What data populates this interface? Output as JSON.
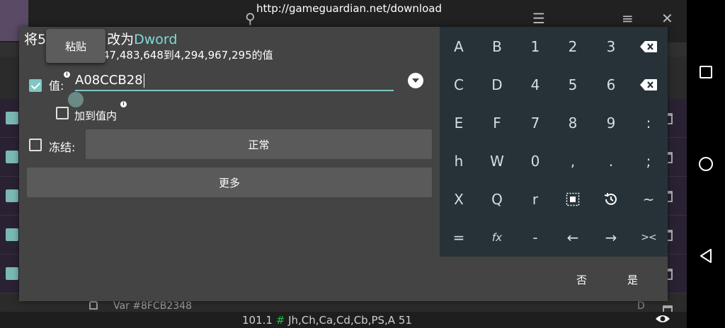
{
  "url_bar": "http://gameguardian.net/download",
  "background": {
    "var_label": "Var #8FCB2348",
    "var_type": "D",
    "status": {
      "prefix": "101.1 ",
      "hash": "#",
      "rest": " Jh,Ch,Ca,Cd,Cb,PS,A 51"
    }
  },
  "dialog": {
    "title_prefix": "将5",
    "title_middle": "改为",
    "title_type": "Dword",
    "subtitle": "47,483,648到4,294,967,295的值",
    "paste_label": "粘贴",
    "value_label": "值:",
    "value_text": "A08CCB28",
    "add_to_value_label": "加到值内",
    "freeze_label": "冻结:",
    "freeze_mode": "正常",
    "more_label": "更多",
    "cancel_label": "否",
    "ok_label": "是"
  },
  "keyboard": {
    "keys": [
      [
        "A",
        "B",
        "1",
        "2",
        "3",
        "backspace"
      ],
      [
        "C",
        "D",
        "4",
        "5",
        "6",
        "clear"
      ],
      [
        "E",
        "F",
        "7",
        "8",
        "9",
        ":"
      ],
      [
        "h",
        "W",
        "0",
        ",",
        ".",
        ";"
      ],
      [
        "X",
        "Q",
        "r",
        "select-all",
        "history",
        "~"
      ],
      [
        "=",
        "fx",
        "-",
        "←",
        "→",
        "><"
      ]
    ]
  },
  "colors": {
    "accent": "#7fdcd8",
    "check": "#7ec7c2",
    "keyboard_bg": "#263238",
    "dialog_bg": "#444444",
    "status_hash": "#1fbf4a"
  }
}
